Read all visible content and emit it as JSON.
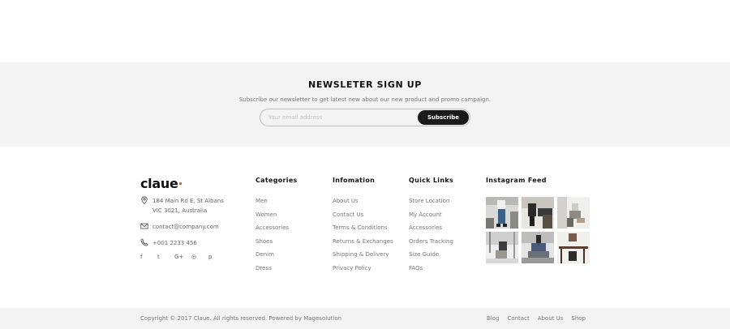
{
  "newsletter": {
    "title": "NEWSLETER SIGN UP",
    "subtitle": "Subscribe our newsletter to get latest new about our new product and promo campaign.",
    "placeholder": "Your email address",
    "button_label": "Subscribe"
  },
  "footer": {
    "logo": "claue",
    "contact": {
      "address_line1": "184 Main Rd E, St Albans",
      "address_line2": "VIC 3021, Australia",
      "email": "contact@company.com",
      "phone": "+001 2233 456"
    },
    "social": [
      {
        "icon": "facebook-icon",
        "glyph": "f"
      },
      {
        "icon": "twitter-icon",
        "glyph": "t"
      },
      {
        "icon": "google-plus-icon",
        "glyph": "G+"
      },
      {
        "icon": "instagram-icon",
        "glyph": "◎"
      },
      {
        "icon": "pinterest-icon",
        "glyph": "p"
      }
    ],
    "categories": {
      "title": "Categories",
      "items": [
        "Men",
        "Women",
        "Accessories",
        "Shoes",
        "Denim",
        "Dress"
      ]
    },
    "information": {
      "title": "Infomation",
      "items": [
        "About Us",
        "Contact Us",
        "Terms & Conditions",
        "Returns & Exchanges",
        "Shipping & Delivery",
        "Privacy Policy"
      ]
    },
    "quick_links": {
      "title": "Quick Links",
      "items": [
        "Store Location",
        "My Account",
        "Accessories",
        "Orders Tracking",
        "Size Guide",
        "FAQs"
      ]
    },
    "instagram": {
      "title": "Instagram Feed",
      "images": [
        {
          "name": "instagram-photo-1",
          "bg": "#8a8f96"
        },
        {
          "name": "instagram-photo-2",
          "bg": "#9b9690"
        },
        {
          "name": "instagram-photo-3",
          "bg": "#b4b0aa"
        },
        {
          "name": "instagram-photo-4",
          "bg": "#c9c9c9"
        },
        {
          "name": "instagram-photo-5",
          "bg": "#6e6e70"
        },
        {
          "name": "instagram-photo-6",
          "bg": "#a99c92"
        }
      ]
    }
  },
  "bottom": {
    "copyright": "Copyright © 2017 Claue. All rights reserved. Powered by Magesolution",
    "links": [
      "Blog",
      "Contact",
      "About Us",
      "Shop"
    ]
  },
  "colors": {
    "accent": "#e05a2b",
    "button": "#1a1a1a",
    "band": "#f3f3f3"
  }
}
